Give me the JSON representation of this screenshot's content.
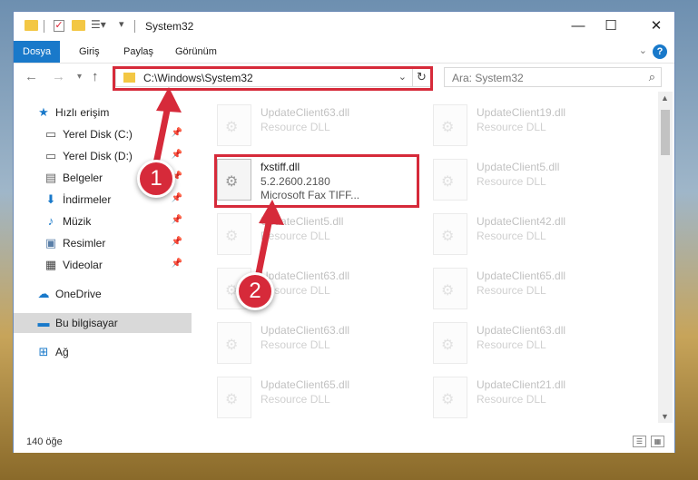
{
  "window": {
    "title": "System32"
  },
  "ribbon": {
    "tabs": [
      "Dosya",
      "Giriş",
      "Paylaş",
      "Görünüm"
    ],
    "active_tab": "Dosya",
    "help": "?"
  },
  "address": {
    "path": "C:\\Windows\\System32",
    "search_placeholder": "Ara: System32"
  },
  "sidebar": {
    "items": [
      {
        "label": "Hızlı erişim",
        "icon": "star-icon"
      },
      {
        "label": "Yerel Disk (C:)",
        "icon": "drive-icon",
        "pinned": true
      },
      {
        "label": "Yerel Disk (D:)",
        "icon": "drive-icon",
        "pinned": true
      },
      {
        "label": "Belgeler",
        "icon": "documents-icon",
        "pinned": true
      },
      {
        "label": "İndirmeler",
        "icon": "download-icon",
        "pinned": true
      },
      {
        "label": "Müzik",
        "icon": "music-icon",
        "pinned": true
      },
      {
        "label": "Resimler",
        "icon": "pictures-icon",
        "pinned": true
      },
      {
        "label": "Videolar",
        "icon": "videos-icon",
        "pinned": true
      },
      {
        "label": "OneDrive",
        "icon": "cloud-icon"
      },
      {
        "label": "Bu bilgisayar",
        "icon": "computer-icon",
        "selected": true
      },
      {
        "label": "Ağ",
        "icon": "network-icon"
      }
    ]
  },
  "files": {
    "highlighted": {
      "name": "fxstiff.dll",
      "version": "5.2.2600.2180",
      "company": "Microsoft   Fax TIFF..."
    },
    "left_column": [
      {
        "name": "UpdateClient63.dll",
        "desc": "Resource DLL"
      },
      {
        "name": "UpdateClient5.dll",
        "desc": "Resource DLL"
      },
      {
        "name": "UpdateClient63.dll",
        "desc": "Resource DLL"
      },
      {
        "name": "UpdateClient63.dll",
        "desc": "Resource DLL"
      },
      {
        "name": "UpdateClient65.dll",
        "desc": "Resource DLL"
      }
    ],
    "right_column": [
      {
        "name": "UpdateClient19.dll",
        "desc": "Resource DLL"
      },
      {
        "name": "UpdateClient5.dll",
        "desc": "Resource DLL"
      },
      {
        "name": "UpdateClient42.dll",
        "desc": "Resource DLL"
      },
      {
        "name": "UpdateClient65.dll",
        "desc": "Resource DLL"
      },
      {
        "name": "UpdateClient63.dll",
        "desc": "Resource DLL"
      },
      {
        "name": "UpdateClient21.dll",
        "desc": "Resource DLL"
      }
    ]
  },
  "status": {
    "count": "140 öğe"
  },
  "annotations": {
    "step1": "1",
    "step2": "2",
    "color": "#d62a3a"
  }
}
